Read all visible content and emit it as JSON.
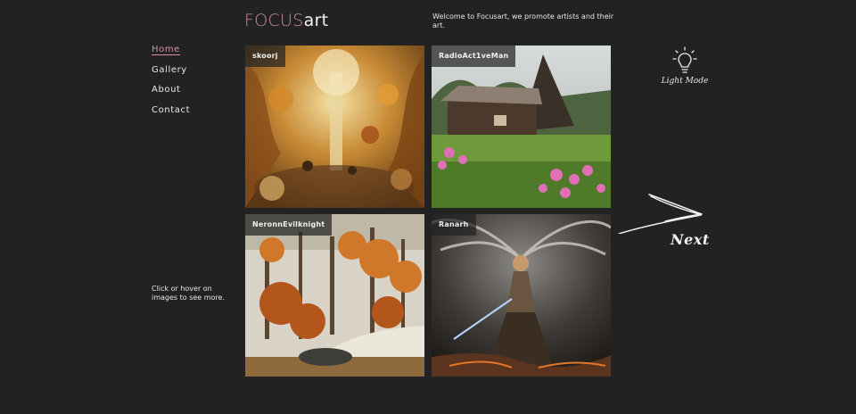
{
  "header": {
    "logo_focus": "FOCUS",
    "logo_art": "art",
    "welcome": "Welcome to Focusart, we promote artists and their art."
  },
  "nav": {
    "items": [
      {
        "label": "Home",
        "active": true
      },
      {
        "label": "Gallery"
      },
      {
        "label": "About"
      },
      {
        "label": "Contact"
      }
    ]
  },
  "hint": "Click or hover on images to see more.",
  "gallery": [
    {
      "artist": "skoorj",
      "subject": "surreal golden forest"
    },
    {
      "artist": "RadioAct1veMan",
      "subject": "cabin in flower meadow"
    },
    {
      "artist": "NeronnEvilknight",
      "subject": "autumn forest"
    },
    {
      "artist": "Ranarh",
      "subject": "storm warrior woman"
    }
  ],
  "light_mode": {
    "label": "Light Mode",
    "icon": "lightbulb-icon"
  },
  "next": {
    "label": "Next",
    "icon": "arrow-right-icon"
  },
  "colors": {
    "background": "#222222",
    "accent": "#d88fa1",
    "text": "#e8e8e8"
  }
}
